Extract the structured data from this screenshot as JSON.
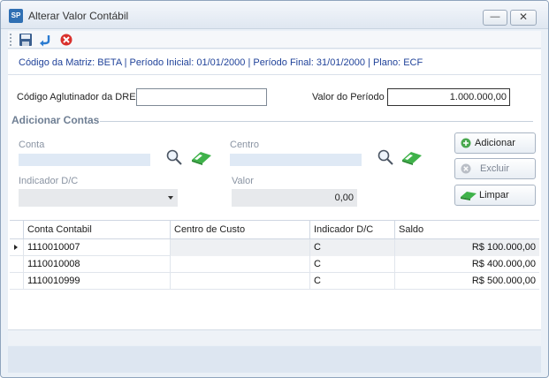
{
  "window": {
    "title": "Alterar Valor Contábil",
    "app_icon_text": "SP",
    "minimize_label": "—",
    "close_label": "✕"
  },
  "toolbar": {
    "icons": [
      "save-icon",
      "undo-icon",
      "cancel-icon"
    ]
  },
  "info": {
    "text": "Código da Matriz: BETA | Período Inicial: 01/01/2000 | Período Final: 31/01/2000 | Plano: ECF"
  },
  "form": {
    "aglutinador_label": "Código Aglutinador da DRE",
    "aglutinador_value": "",
    "valor_periodo_label": "Valor do Período",
    "valor_periodo_value": "1.000.000,00"
  },
  "group": {
    "title": "Adicionar Contas",
    "conta_label": "Conta",
    "conta_value": "",
    "centro_label": "Centro",
    "centro_value": "",
    "indicador_label": "Indicador D/C",
    "indicador_value": "",
    "valor_label": "Valor",
    "valor_value": "0,00"
  },
  "buttons": {
    "adicionar": "Adicionar",
    "excluir": "Excluir",
    "limpar": "Limpar"
  },
  "grid": {
    "columns": [
      "Conta Contabil",
      "Centro de Custo",
      "Indicador D/C",
      "Saldo"
    ],
    "rows": [
      {
        "conta": "1110010007",
        "centro": "",
        "indicador": "C",
        "saldo": "R$ 100.000,00"
      },
      {
        "conta": "1110010008",
        "centro": "",
        "indicador": "C",
        "saldo": "R$ 400.000,00"
      },
      {
        "conta": "1110010999",
        "centro": "",
        "indicador": "C",
        "saldo": "R$ 500.000,00"
      }
    ],
    "selected_row": 0
  },
  "colors": {
    "accent_text": "#21439a",
    "disabled_field": "#dfe9f5",
    "window_border": "#8fa4bd"
  }
}
